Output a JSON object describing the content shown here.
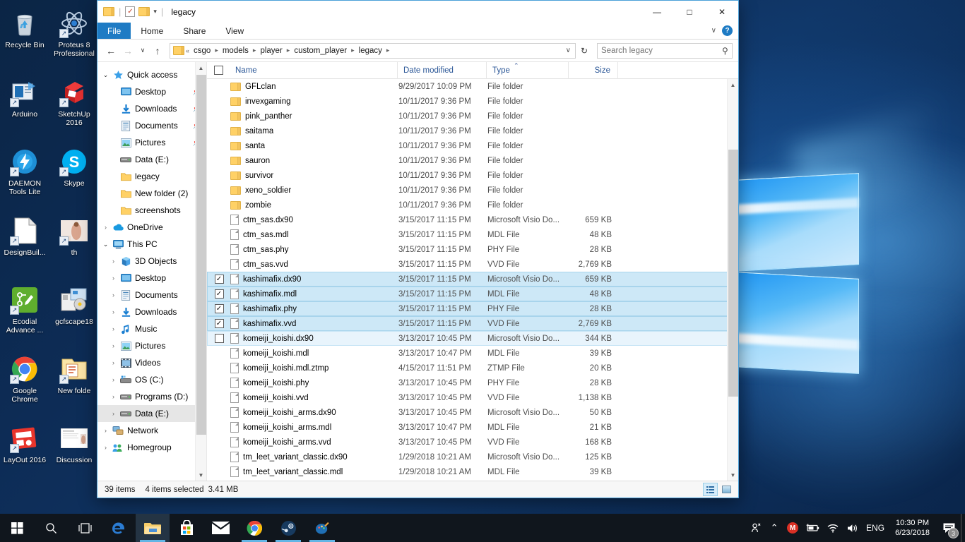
{
  "desktop": {
    "icons": [
      {
        "label": "Recycle Bin",
        "icon": "recycle-bin-icon",
        "shortcut": false
      },
      {
        "label": "Proteus 8 Professional",
        "icon": "proteus-icon",
        "shortcut": true
      },
      {
        "label": "Arduino",
        "icon": "arduino-icon",
        "shortcut": true
      },
      {
        "label": "SketchUp 2016",
        "icon": "sketchup-icon",
        "shortcut": true
      },
      {
        "label": "DAEMON Tools Lite",
        "icon": "daemon-tools-icon",
        "shortcut": true
      },
      {
        "label": "Skype",
        "icon": "skype-icon",
        "shortcut": true
      },
      {
        "label": "DesignBuil...",
        "icon": "document-icon",
        "shortcut": true
      },
      {
        "label": "th",
        "icon": "image-thumbnail-icon",
        "shortcut": true
      },
      {
        "label": "Ecodial Advance ...",
        "icon": "ecodial-icon",
        "shortcut": true
      },
      {
        "label": "gcfscape18",
        "icon": "gcfscape-icon",
        "shortcut": false
      },
      {
        "label": "Google Chrome",
        "icon": "chrome-icon",
        "shortcut": true
      },
      {
        "label": "New folde",
        "icon": "folder-shortcut-icon",
        "shortcut": true
      },
      {
        "label": "LayOut 2016",
        "icon": "layout-icon",
        "shortcut": true
      },
      {
        "label": "Discussion",
        "icon": "document-thumbnail-icon",
        "shortcut": false
      }
    ]
  },
  "explorer": {
    "title": "legacy",
    "quick_access_toolbar": {
      "folder_label": "folder-icon",
      "properties_label": "properties-icon",
      "new_folder_label": "new-folder-icon",
      "customize_label": "customize-dropdown"
    },
    "window_controls": {
      "minimize": "—",
      "maximize": "□",
      "close": "✕"
    },
    "ribbon_tabs": [
      {
        "label": "File",
        "active": true
      },
      {
        "label": "Home",
        "active": false
      },
      {
        "label": "Share",
        "active": false
      },
      {
        "label": "View",
        "active": false
      }
    ],
    "ribbon_right": {
      "collapse": "∨",
      "help": "?"
    },
    "address": {
      "back": "←",
      "forward": "→",
      "recent": "∨",
      "up": "↑",
      "overflow": "«",
      "crumbs": [
        "csgo",
        "models",
        "player",
        "custom_player",
        "legacy"
      ],
      "dropdown": "∨",
      "refresh": "↻"
    },
    "search": {
      "placeholder": "Search legacy",
      "value": "",
      "icon": "search-icon"
    },
    "nav_pane": [
      {
        "label": "Quick access",
        "icon": "star-icon",
        "expander": "∨",
        "level": 0,
        "pinned": false,
        "selected": false
      },
      {
        "label": "Desktop",
        "icon": "desktop-icon",
        "expander": "",
        "level": 1,
        "pinned": true,
        "selected": false
      },
      {
        "label": "Downloads",
        "icon": "downloads-icon",
        "expander": "",
        "level": 1,
        "pinned": true,
        "selected": false
      },
      {
        "label": "Documents",
        "icon": "documents-icon",
        "expander": "",
        "level": 1,
        "pinned": true,
        "selected": false
      },
      {
        "label": "Pictures",
        "icon": "pictures-icon",
        "expander": "",
        "level": 1,
        "pinned": true,
        "selected": false
      },
      {
        "label": "Data (E:)",
        "icon": "drive-icon",
        "expander": "",
        "level": 1,
        "pinned": false,
        "selected": false
      },
      {
        "label": "legacy",
        "icon": "folder-icon",
        "expander": "",
        "level": 1,
        "pinned": false,
        "selected": false
      },
      {
        "label": "New folder (2)",
        "icon": "folder-icon",
        "expander": "",
        "level": 1,
        "pinned": false,
        "selected": false
      },
      {
        "label": "screenshots",
        "icon": "folder-icon",
        "expander": "",
        "level": 1,
        "pinned": false,
        "selected": false
      },
      {
        "label": "OneDrive",
        "icon": "onedrive-icon",
        "expander": "›",
        "level": 0,
        "pinned": false,
        "selected": false
      },
      {
        "label": "This PC",
        "icon": "this-pc-icon",
        "expander": "∨",
        "level": 0,
        "pinned": false,
        "selected": false
      },
      {
        "label": "3D Objects",
        "icon": "3d-objects-icon",
        "expander": "›",
        "level": 1,
        "pinned": false,
        "selected": false
      },
      {
        "label": "Desktop",
        "icon": "desktop-icon",
        "expander": "›",
        "level": 1,
        "pinned": false,
        "selected": false
      },
      {
        "label": "Documents",
        "icon": "documents-icon",
        "expander": "›",
        "level": 1,
        "pinned": false,
        "selected": false
      },
      {
        "label": "Downloads",
        "icon": "downloads-icon",
        "expander": "›",
        "level": 1,
        "pinned": false,
        "selected": false
      },
      {
        "label": "Music",
        "icon": "music-icon",
        "expander": "›",
        "level": 1,
        "pinned": false,
        "selected": false
      },
      {
        "label": "Pictures",
        "icon": "pictures-icon",
        "expander": "›",
        "level": 1,
        "pinned": false,
        "selected": false
      },
      {
        "label": "Videos",
        "icon": "videos-icon",
        "expander": "›",
        "level": 1,
        "pinned": false,
        "selected": false
      },
      {
        "label": "OS (C:)",
        "icon": "os-drive-icon",
        "expander": "›",
        "level": 1,
        "pinned": false,
        "selected": false
      },
      {
        "label": "Programs (D:)",
        "icon": "drive-icon",
        "expander": "›",
        "level": 1,
        "pinned": false,
        "selected": false
      },
      {
        "label": "Data (E:)",
        "icon": "drive-icon",
        "expander": "›",
        "level": 1,
        "pinned": false,
        "selected": true
      },
      {
        "label": "Network",
        "icon": "network-icon",
        "expander": "›",
        "level": 0,
        "pinned": false,
        "selected": false
      },
      {
        "label": "Homegroup",
        "icon": "homegroup-icon",
        "expander": "›",
        "level": 0,
        "pinned": false,
        "selected": false
      }
    ],
    "columns": [
      {
        "key": "name",
        "label": "Name"
      },
      {
        "key": "date",
        "label": "Date modified"
      },
      {
        "key": "type",
        "label": "Type"
      },
      {
        "key": "size",
        "label": "Size"
      }
    ],
    "sort": {
      "column": "Name",
      "direction": "ascending",
      "marker": "⌃"
    },
    "files": [
      {
        "name": "GFLclan",
        "date": "9/29/2017 10:09 PM",
        "type": "File folder",
        "size": "",
        "icon": "folder-icon",
        "checked": false,
        "selected": false,
        "hover": false
      },
      {
        "name": "invexgaming",
        "date": "10/11/2017 9:36 PM",
        "type": "File folder",
        "size": "",
        "icon": "folder-icon",
        "checked": false,
        "selected": false,
        "hover": false
      },
      {
        "name": "pink_panther",
        "date": "10/11/2017 9:36 PM",
        "type": "File folder",
        "size": "",
        "icon": "folder-icon",
        "checked": false,
        "selected": false,
        "hover": false
      },
      {
        "name": "saitama",
        "date": "10/11/2017 9:36 PM",
        "type": "File folder",
        "size": "",
        "icon": "folder-icon",
        "checked": false,
        "selected": false,
        "hover": false
      },
      {
        "name": "santa",
        "date": "10/11/2017 9:36 PM",
        "type": "File folder",
        "size": "",
        "icon": "folder-icon",
        "checked": false,
        "selected": false,
        "hover": false
      },
      {
        "name": "sauron",
        "date": "10/11/2017 9:36 PM",
        "type": "File folder",
        "size": "",
        "icon": "folder-icon",
        "checked": false,
        "selected": false,
        "hover": false
      },
      {
        "name": "survivor",
        "date": "10/11/2017 9:36 PM",
        "type": "File folder",
        "size": "",
        "icon": "folder-icon",
        "checked": false,
        "selected": false,
        "hover": false
      },
      {
        "name": "xeno_soldier",
        "date": "10/11/2017 9:36 PM",
        "type": "File folder",
        "size": "",
        "icon": "folder-icon",
        "checked": false,
        "selected": false,
        "hover": false
      },
      {
        "name": "zombie",
        "date": "10/11/2017 9:36 PM",
        "type": "File folder",
        "size": "",
        "icon": "folder-icon",
        "checked": false,
        "selected": false,
        "hover": false
      },
      {
        "name": "ctm_sas.dx90",
        "date": "3/15/2017 11:15 PM",
        "type": "Microsoft Visio Do...",
        "size": "659 KB",
        "icon": "file-icon",
        "checked": false,
        "selected": false,
        "hover": false
      },
      {
        "name": "ctm_sas.mdl",
        "date": "3/15/2017 11:15 PM",
        "type": "MDL File",
        "size": "48 KB",
        "icon": "file-icon",
        "checked": false,
        "selected": false,
        "hover": false
      },
      {
        "name": "ctm_sas.phy",
        "date": "3/15/2017 11:15 PM",
        "type": "PHY File",
        "size": "28 KB",
        "icon": "file-icon",
        "checked": false,
        "selected": false,
        "hover": false
      },
      {
        "name": "ctm_sas.vvd",
        "date": "3/15/2017 11:15 PM",
        "type": "VVD File",
        "size": "2,769 KB",
        "icon": "file-icon",
        "checked": false,
        "selected": false,
        "hover": false
      },
      {
        "name": "kashimafix.dx90",
        "date": "3/15/2017 11:15 PM",
        "type": "Microsoft Visio Do...",
        "size": "659 KB",
        "icon": "file-icon",
        "checked": true,
        "selected": true,
        "hover": false
      },
      {
        "name": "kashimafix.mdl",
        "date": "3/15/2017 11:15 PM",
        "type": "MDL File",
        "size": "48 KB",
        "icon": "file-icon",
        "checked": true,
        "selected": true,
        "hover": false
      },
      {
        "name": "kashimafix.phy",
        "date": "3/15/2017 11:15 PM",
        "type": "PHY File",
        "size": "28 KB",
        "icon": "file-icon",
        "checked": true,
        "selected": true,
        "hover": false
      },
      {
        "name": "kashimafix.vvd",
        "date": "3/15/2017 11:15 PM",
        "type": "VVD File",
        "size": "2,769 KB",
        "icon": "file-icon",
        "checked": true,
        "selected": true,
        "hover": false
      },
      {
        "name": "komeiji_koishi.dx90",
        "date": "3/13/2017 10:45 PM",
        "type": "Microsoft Visio Do...",
        "size": "344 KB",
        "icon": "file-icon",
        "checked": false,
        "selected": false,
        "hover": true
      },
      {
        "name": "komeiji_koishi.mdl",
        "date": "3/13/2017 10:47 PM",
        "type": "MDL File",
        "size": "39 KB",
        "icon": "file-icon",
        "checked": false,
        "selected": false,
        "hover": false
      },
      {
        "name": "komeiji_koishi.mdl.ztmp",
        "date": "4/15/2017 11:51 PM",
        "type": "ZTMP File",
        "size": "20 KB",
        "icon": "file-icon",
        "checked": false,
        "selected": false,
        "hover": false
      },
      {
        "name": "komeiji_koishi.phy",
        "date": "3/13/2017 10:45 PM",
        "type": "PHY File",
        "size": "28 KB",
        "icon": "file-icon",
        "checked": false,
        "selected": false,
        "hover": false
      },
      {
        "name": "komeiji_koishi.vvd",
        "date": "3/13/2017 10:45 PM",
        "type": "VVD File",
        "size": "1,138 KB",
        "icon": "file-icon",
        "checked": false,
        "selected": false,
        "hover": false
      },
      {
        "name": "komeiji_koishi_arms.dx90",
        "date": "3/13/2017 10:45 PM",
        "type": "Microsoft Visio Do...",
        "size": "50 KB",
        "icon": "file-icon",
        "checked": false,
        "selected": false,
        "hover": false
      },
      {
        "name": "komeiji_koishi_arms.mdl",
        "date": "3/13/2017 10:47 PM",
        "type": "MDL File",
        "size": "21 KB",
        "icon": "file-icon",
        "checked": false,
        "selected": false,
        "hover": false
      },
      {
        "name": "komeiji_koishi_arms.vvd",
        "date": "3/13/2017 10:45 PM",
        "type": "VVD File",
        "size": "168 KB",
        "icon": "file-icon",
        "checked": false,
        "selected": false,
        "hover": false
      },
      {
        "name": "tm_leet_variant_classic.dx90",
        "date": "1/29/2018 10:21 AM",
        "type": "Microsoft Visio Do...",
        "size": "125 KB",
        "icon": "file-icon",
        "checked": false,
        "selected": false,
        "hover": false
      },
      {
        "name": "tm_leet_variant_classic.mdl",
        "date": "1/29/2018 10:21 AM",
        "type": "MDL File",
        "size": "39 KB",
        "icon": "file-icon",
        "checked": false,
        "selected": false,
        "hover": false
      }
    ],
    "status": {
      "item_count": "39 items",
      "selection": "4 items selected",
      "selection_size": "3.41 MB"
    },
    "view_buttons": [
      {
        "name": "details-view",
        "active": true
      },
      {
        "name": "large-icons-view",
        "active": false
      }
    ]
  },
  "taskbar": {
    "start": "start-button",
    "search": "search-icon",
    "task_view": "task-view-icon",
    "apps": [
      {
        "name": "edge-icon",
        "label": "e",
        "open": false,
        "active": false
      },
      {
        "name": "file-explorer-icon",
        "label": "",
        "open": true,
        "active": true
      },
      {
        "name": "microsoft-store-icon",
        "label": "",
        "open": false,
        "active": false
      },
      {
        "name": "mail-icon",
        "label": "",
        "open": false,
        "active": false
      },
      {
        "name": "chrome-icon",
        "label": "",
        "open": true,
        "active": false
      },
      {
        "name": "steam-icon",
        "label": "",
        "open": true,
        "active": false
      },
      {
        "name": "paint3d-icon",
        "label": "",
        "open": true,
        "active": false
      }
    ],
    "tray": {
      "people": "people-icon",
      "show_hidden": "⌃",
      "gmail": "M",
      "battery": "battery-icon",
      "wifi": "wifi-icon",
      "volume": "volume-icon",
      "language": "ENG",
      "time": "10:30 PM",
      "date": "6/23/2018",
      "notification_icon": "notifications-icon",
      "notification_count": "3"
    }
  },
  "colors": {
    "accent": "#0078d7",
    "file_tab": "#1e7bc4",
    "selection": "#cde8f7",
    "hover": "#e8f4fc",
    "folder_yellow": "#ffd166",
    "taskbar": "#10161d"
  }
}
